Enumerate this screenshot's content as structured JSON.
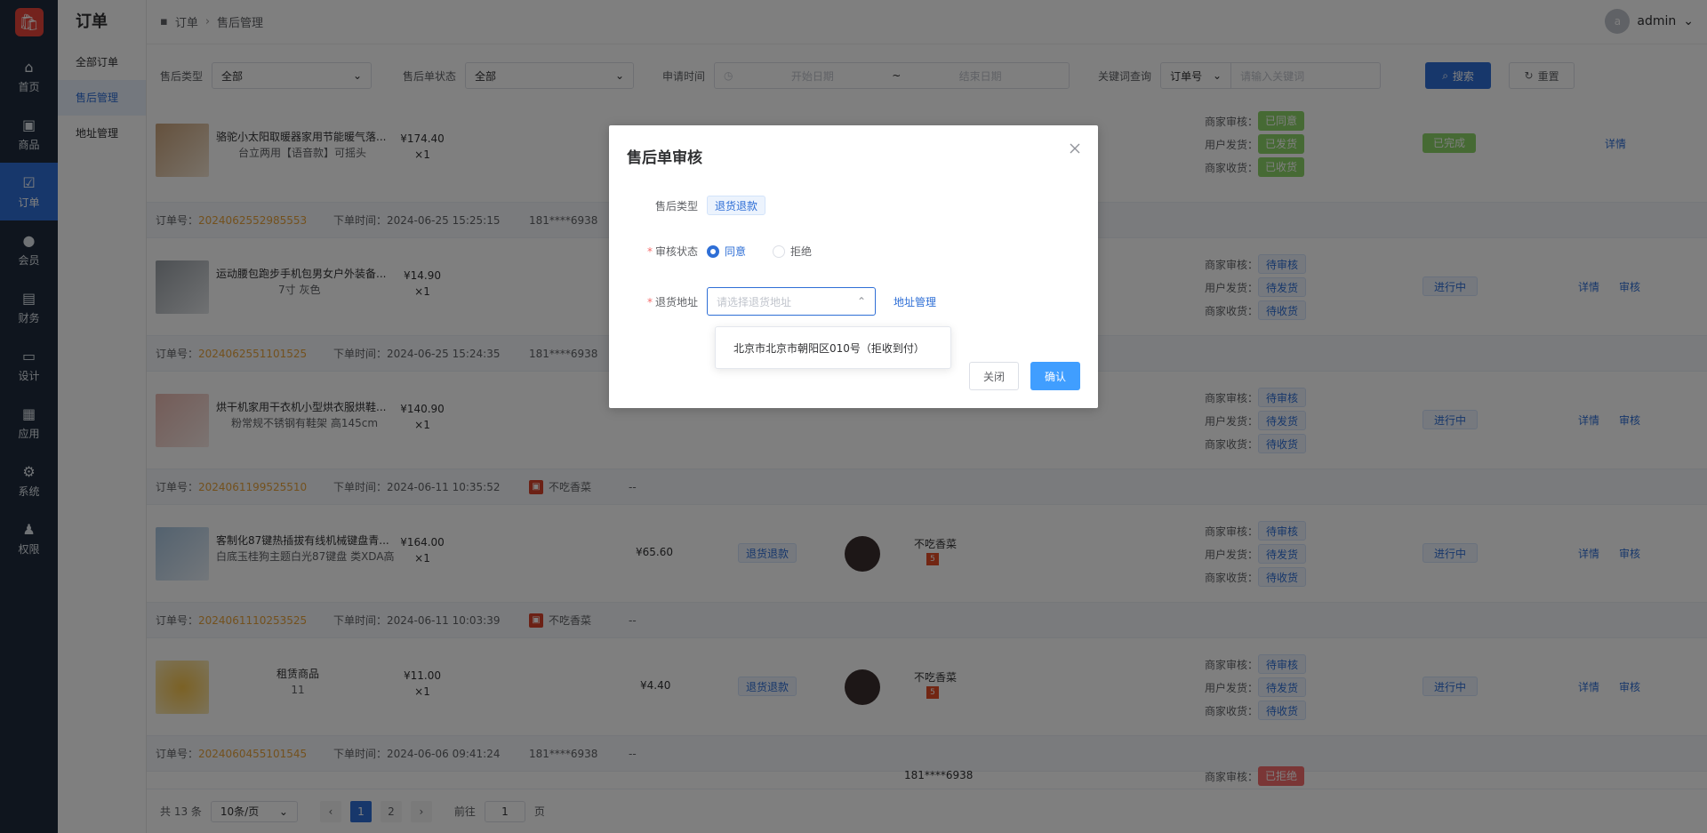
{
  "nav": {
    "items": [
      {
        "label": "首页",
        "icon": "home-icon"
      },
      {
        "label": "商品",
        "icon": "bag-icon"
      },
      {
        "label": "订单",
        "icon": "order-icon"
      },
      {
        "label": "会员",
        "icon": "user-icon"
      },
      {
        "label": "财务",
        "icon": "finance-icon"
      },
      {
        "label": "设计",
        "icon": "monitor-icon"
      },
      {
        "label": "应用",
        "icon": "apps-icon"
      },
      {
        "label": "系统",
        "icon": "gear-icon"
      },
      {
        "label": "权限",
        "icon": "person-icon"
      }
    ],
    "active_index": 2
  },
  "submenu": {
    "title": "订单",
    "items": [
      "全部订单",
      "售后管理",
      "地址管理"
    ],
    "active_index": 1
  },
  "header": {
    "breadcrumb_root": "订单",
    "breadcrumb_current": "售后管理",
    "avatar_letter": "a",
    "username": "admin"
  },
  "filters": {
    "type_label": "售后类型",
    "type_value": "全部",
    "status_label": "售后单状态",
    "status_value": "全部",
    "date_label": "申请时间",
    "date_start_placeholder": "开始日期",
    "date_sep": "~",
    "date_end_placeholder": "结束日期",
    "keyword_label": "关键词查询",
    "keyword_type": "订单号",
    "keyword_placeholder": "请输入关键词",
    "search_button": "搜索",
    "reset_button": "重置"
  },
  "labels": {
    "order_no": "订单号：",
    "order_time": "下单时间：",
    "merchant_review": "商家审核：",
    "user_ship": "用户发货：",
    "merchant_receive": "商家收货：",
    "detail": "详情",
    "review": "审核"
  },
  "orders": [
    {
      "no": "",
      "time": "",
      "buyer": "",
      "product": "骆驼小太阳取暖器家用节能暖气落...",
      "spec": "台立两用【语音款】可摇头",
      "price": "¥174.40",
      "qty": "×1",
      "s1": "已同意",
      "s2": "已发货",
      "s3": "已收货",
      "state": "已完成",
      "ops": [
        "详情"
      ]
    },
    {
      "no": "2024062552985553",
      "time": "2024-06-25 15:25:15",
      "buyer": "181****6938",
      "product": "运动腰包跑步手机包男女户外装备...",
      "spec": "7寸 灰色",
      "price": "¥14.90",
      "qty": "×1",
      "s1": "待审核",
      "s2": "待发货",
      "s3": "待收货",
      "state": "进行中",
      "ops": [
        "详情",
        "审核"
      ]
    },
    {
      "no": "2024062551101525",
      "time": "2024-06-25 15:24:35",
      "buyer": "181****6938",
      "product": "烘干机家用干衣机小型烘衣服烘鞋...",
      "spec": "粉常规不锈钢有鞋架 高145cm",
      "price": "¥140.90",
      "qty": "×1",
      "s1": "待审核",
      "s2": "待发货",
      "s3": "待收货",
      "state": "进行中",
      "ops": [
        "详情",
        "审核"
      ]
    },
    {
      "no": "2024061199525510",
      "time": "2024-06-11 10:35:52",
      "buyer": "不吃香菜",
      "product": "客制化87键热插拔有线机械键盘青...",
      "spec": "白底玉桂狗主题白光87键盘 类XDA高",
      "price": "¥164.00",
      "qty": "×1",
      "paid": "¥65.60",
      "type": "退货退款",
      "buyer_name": "不吃香菜",
      "s1": "待审核",
      "s2": "待发货",
      "s3": "待收货",
      "state": "进行中",
      "ops": [
        "详情",
        "审核"
      ]
    },
    {
      "no": "2024061110253525",
      "time": "2024-06-11 10:03:39",
      "buyer": "不吃香菜",
      "product": "租赁商品",
      "spec": "11",
      "price": "¥11.00",
      "qty": "×1",
      "paid": "¥4.40",
      "type": "退货退款",
      "buyer_name": "不吃香菜",
      "s1": "待审核",
      "s2": "待发货",
      "s3": "待收货",
      "state": "进行中",
      "ops": [
        "详情",
        "审核"
      ]
    },
    {
      "no": "2024060455101545",
      "time": "2024-06-06 09:41:24",
      "buyer": "181****6938",
      "extra": "--",
      "s1": "已拒绝",
      "partial_buyer": "181****6938"
    }
  ],
  "row_dashes": "--",
  "pager": {
    "total": "共 13 条",
    "size": "10条/页",
    "pages": [
      "1",
      "2"
    ],
    "goto_label": "前往",
    "goto_value": "1",
    "page_unit": "页"
  },
  "dialog": {
    "title": "售后单审核",
    "type_label": "售后类型",
    "type_value": "退货退款",
    "status_label": "审核状态",
    "agree": "同意",
    "reject": "拒绝",
    "address_label": "退货地址",
    "address_placeholder": "请选择退货地址",
    "address_manage": "地址管理",
    "address_option": "北京市北京市朝阳区010号（拒收到付）",
    "close_button": "关闭",
    "confirm_button": "确认"
  },
  "colors": {
    "primary": "#2f6fd6",
    "warning": "#e6a23c",
    "danger": "#f56c6c",
    "success": "#8dd468",
    "nav_bg": "#1e2b3d"
  }
}
